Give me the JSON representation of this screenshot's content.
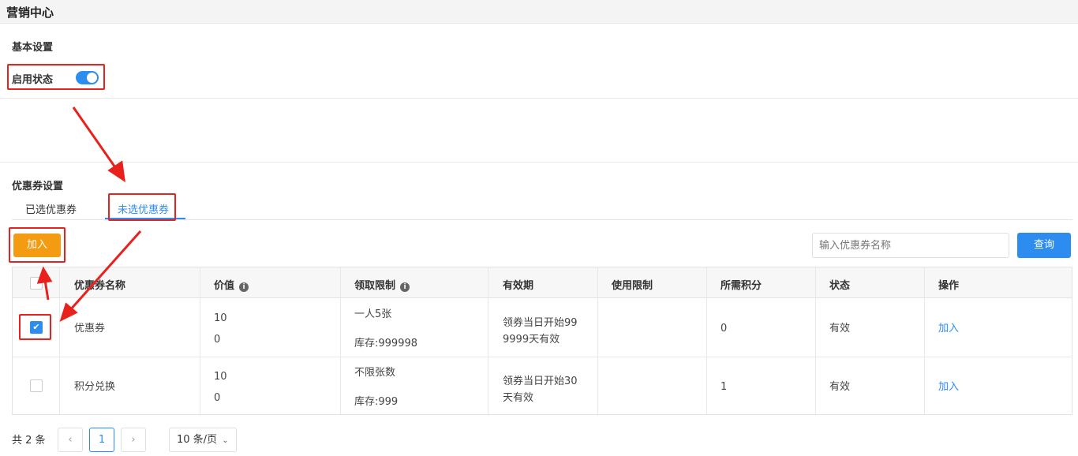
{
  "header": {
    "title": "营销中心"
  },
  "basic": {
    "section_title": "基本设置",
    "status_label": "启用状态",
    "status_enabled": true
  },
  "coupon": {
    "section_title": "优惠券设置",
    "tabs": [
      {
        "label": "已选优惠券",
        "active": false
      },
      {
        "label": "未选优惠券",
        "active": true
      }
    ],
    "add_button": "加入",
    "search_placeholder": "输入优惠券名称",
    "search_button": "查询"
  },
  "table": {
    "columns": [
      "优惠券名称",
      "价值",
      "领取限制",
      "有效期",
      "使用限制",
      "所需积分",
      "状态",
      "操作"
    ],
    "rows": [
      {
        "checked": true,
        "name": "优惠券",
        "value_line1": "10",
        "value_line2": "0",
        "limit": "一人5张",
        "stock": "库存:999998",
        "validity_line1": "领券当日开始99",
        "validity_line2": "9999天有效",
        "usage": "",
        "points": "0",
        "status": "有效",
        "action": "加入"
      },
      {
        "checked": false,
        "name": "积分兑换",
        "value_line1": "10",
        "value_line2": "0",
        "limit": "不限张数",
        "stock": "库存:999",
        "validity_line1": "领券当日开始30",
        "validity_line2": "天有效",
        "usage": "",
        "points": "1",
        "status": "有效",
        "action": "加入"
      }
    ]
  },
  "pagination": {
    "total": "共 2 条",
    "prev": "‹",
    "current_page": "1",
    "next": "›",
    "page_size": "10 条/页"
  },
  "colors": {
    "primary": "#2d8cf0",
    "add_button": "#f39c12",
    "annotation": "#e8211c"
  }
}
